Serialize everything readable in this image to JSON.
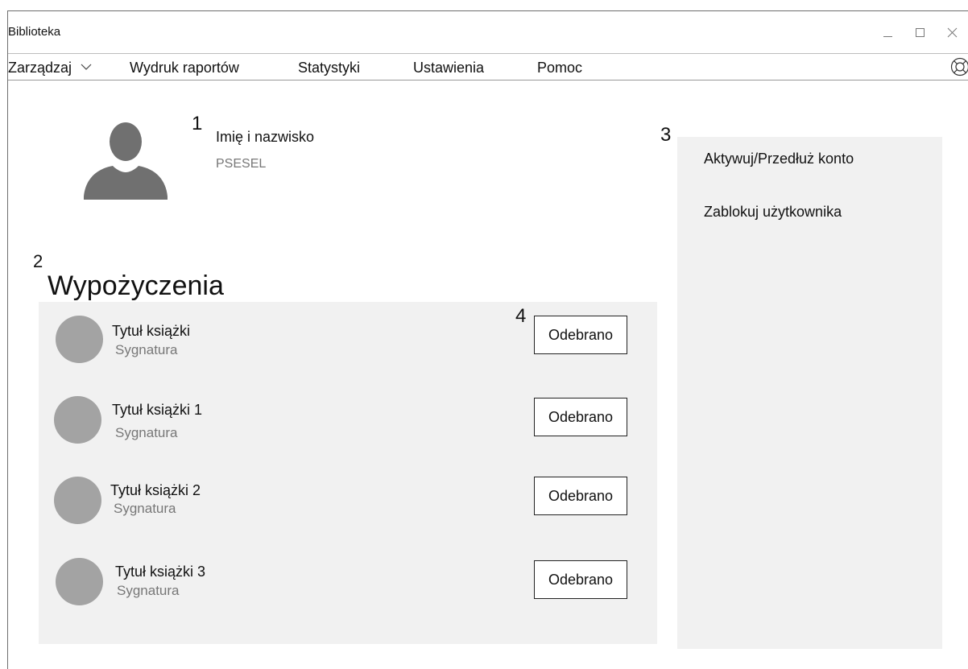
{
  "window": {
    "title": "Biblioteka"
  },
  "menu": {
    "items": [
      {
        "label": "Zarządzaj"
      },
      {
        "label": "Wydruk raportów"
      },
      {
        "label": "Statystyki"
      },
      {
        "label": "Ustawienia"
      },
      {
        "label": "Pomoc"
      }
    ]
  },
  "markers": {
    "profile": "1",
    "loans": "2",
    "actions": "3",
    "button": "4"
  },
  "profile": {
    "name": "Imię i nazwisko",
    "pesel": "PSESEL"
  },
  "loans": {
    "title": "Wypożyczenia",
    "items": [
      {
        "title": "Tytuł książki",
        "signature": "Sygnatura",
        "button": "Odebrano"
      },
      {
        "title": "Tytuł książki 1",
        "signature": "Sygnatura",
        "button": "Odebrano"
      },
      {
        "title": "Tytuł książki 2",
        "signature": "Sygnatura",
        "button": "Odebrano"
      },
      {
        "title": "Tytuł książki 3",
        "signature": "Sygnatura",
        "button": "Odebrano"
      }
    ]
  },
  "actions": {
    "items": [
      {
        "label": "Aktywuj/Przedłuż konto"
      },
      {
        "label": "Zablokuj użytkownika"
      }
    ]
  },
  "icons": {
    "help": "lifebuoy-icon",
    "dropdown": "chevron-down-icon",
    "avatar": "user-silhouette-icon"
  },
  "colors": {
    "panel_bg": "#f1f1f1",
    "placeholder_gray": "#a3a3a3",
    "secondary_text": "#777777"
  }
}
